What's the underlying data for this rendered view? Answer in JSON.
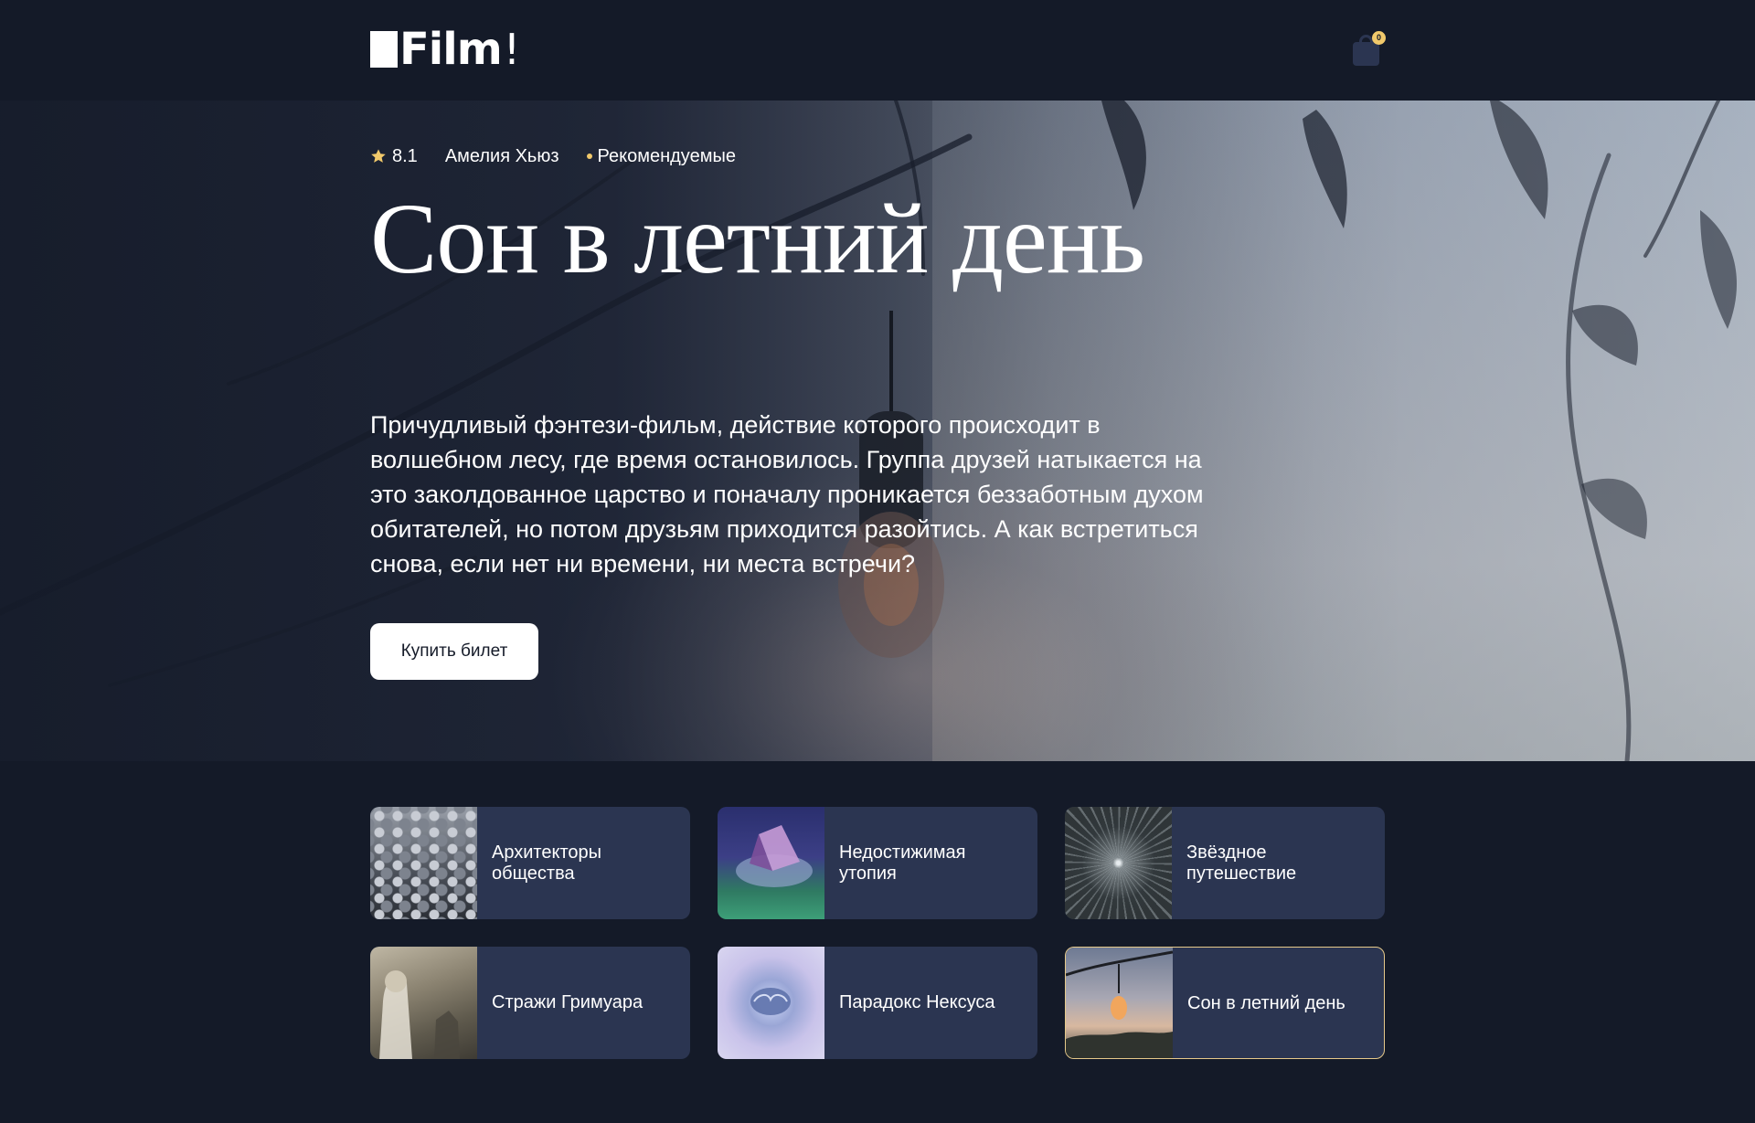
{
  "header": {
    "logo_text": "Film",
    "logo_bang": "!",
    "cart_count": "0",
    "cart_icon": "shopping-bag-icon"
  },
  "hero": {
    "rating": "8.1",
    "author": "Амелия Хьюз",
    "tag": "Рекомендуемые",
    "title": "Сон в летний день",
    "description": "Причудливый фэнтези-фильм, действие которого происходит в волшебном лесу, где время остановилось. Группа друзей натыкается на это заколдованное царство и поначалу проникается беззаботным духом обитателей, но потом друзьям приходится разойтись. А как встретиться снова, если нет ни времени, ни места встречи?",
    "buy_label": "Купить билет"
  },
  "cards": [
    {
      "title": "Архитекторы общества"
    },
    {
      "title": "Недостижимая утопия"
    },
    {
      "title": "Звёздное путешествие"
    },
    {
      "title": "Стражи Гримуара"
    },
    {
      "title": "Парадокс Нексуса"
    },
    {
      "title": "Сон в летний день",
      "active": true
    }
  ],
  "colors": {
    "background": "#141a28",
    "card": "#2b3551",
    "accent": "#f1c96b",
    "active_border": "#e6c98a",
    "button_bg": "#ffffff"
  }
}
